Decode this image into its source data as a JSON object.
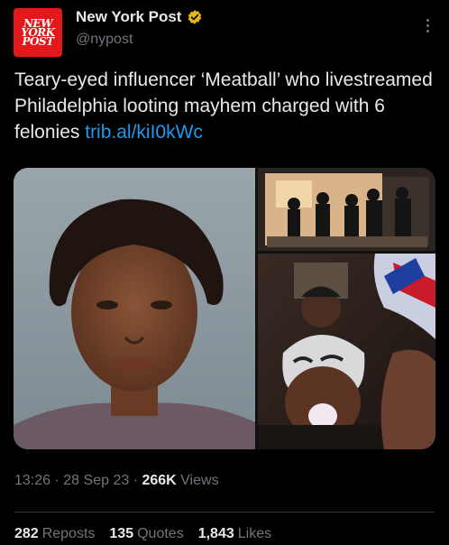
{
  "account": {
    "avatar_lines": [
      "NEW",
      "YORK",
      "POST"
    ],
    "display_name": "New York Post",
    "handle": "@nypost"
  },
  "tweet": {
    "text": "Teary-eyed influencer ‘Meatball’ who livestreamed Philadelphia looting mayhem charged with 6 felonies",
    "link": "trib.al/kiI0kWc"
  },
  "meta": {
    "time": "13:26",
    "separator": "·",
    "date": "28 Sep 23",
    "views_count": "266K",
    "views_label": "Views"
  },
  "stats": {
    "reposts_count": "282",
    "reposts_label": "Reposts",
    "quotes_count": "135",
    "quotes_label": "Quotes",
    "likes_count": "1,843",
    "likes_label": "Likes"
  },
  "colors": {
    "background": "#000000",
    "text": "#e7e9ea",
    "secondary": "#71767b",
    "link": "#1d9bf0",
    "brand": "#e4181b",
    "verified": "#e2b719"
  },
  "icons": {
    "verified": "verified-badge-icon",
    "more": "more-options-icon"
  }
}
